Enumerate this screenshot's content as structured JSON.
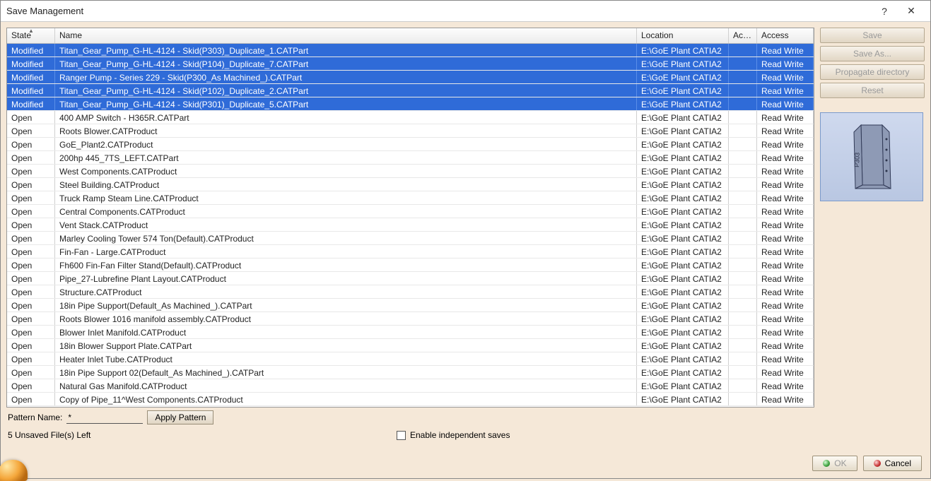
{
  "window": {
    "title": "Save Management",
    "help_tip": "?",
    "close_tip": "✕"
  },
  "columns": {
    "state": "State",
    "name": "Name",
    "location": "Location",
    "action": "Acti...",
    "access": "Access"
  },
  "rows": [
    {
      "state": "Modified",
      "name": "Titan_Gear_Pump_G-HL-4124 - Skid(P303)_Duplicate_1.CATPart",
      "location": "E:\\GoE Plant CATIA2",
      "access": "Read Write",
      "selected": true
    },
    {
      "state": "Modified",
      "name": "Titan_Gear_Pump_G-HL-4124 - Skid(P104)_Duplicate_7.CATPart",
      "location": "E:\\GoE Plant CATIA2",
      "access": "Read Write",
      "selected": true
    },
    {
      "state": "Modified",
      "name": "Ranger Pump - Series 229 - Skid(P300_As Machined_).CATPart",
      "location": "E:\\GoE Plant CATIA2",
      "access": "Read Write",
      "selected": true
    },
    {
      "state": "Modified",
      "name": "Titan_Gear_Pump_G-HL-4124 - Skid(P102)_Duplicate_2.CATPart",
      "location": "E:\\GoE Plant CATIA2",
      "access": "Read Write",
      "selected": true
    },
    {
      "state": "Modified",
      "name": "Titan_Gear_Pump_G-HL-4124 - Skid(P301)_Duplicate_5.CATPart",
      "location": "E:\\GoE Plant CATIA2",
      "access": "Read Write",
      "selected": true
    },
    {
      "state": "Open",
      "name": "400 AMP Switch - H365R.CATPart",
      "location": "E:\\GoE Plant CATIA2",
      "access": "Read Write",
      "selected": false
    },
    {
      "state": "Open",
      "name": "Roots Blower.CATProduct",
      "location": "E:\\GoE Plant CATIA2",
      "access": "Read Write",
      "selected": false
    },
    {
      "state": "Open",
      "name": "GoE_Plant2.CATProduct",
      "location": "E:\\GoE Plant CATIA2",
      "access": "Read Write",
      "selected": false
    },
    {
      "state": "Open",
      "name": "200hp 445_7TS_LEFT.CATPart",
      "location": "E:\\GoE Plant CATIA2",
      "access": "Read Write",
      "selected": false
    },
    {
      "state": "Open",
      "name": "West Components.CATProduct",
      "location": "E:\\GoE Plant CATIA2",
      "access": "Read Write",
      "selected": false
    },
    {
      "state": "Open",
      "name": "Steel Building.CATProduct",
      "location": "E:\\GoE Plant CATIA2",
      "access": "Read Write",
      "selected": false
    },
    {
      "state": "Open",
      "name": "Truck Ramp Steam Line.CATProduct",
      "location": "E:\\GoE Plant CATIA2",
      "access": "Read Write",
      "selected": false
    },
    {
      "state": "Open",
      "name": "Central Components.CATProduct",
      "location": "E:\\GoE Plant CATIA2",
      "access": "Read Write",
      "selected": false
    },
    {
      "state": "Open",
      "name": "Vent Stack.CATProduct",
      "location": "E:\\GoE Plant CATIA2",
      "access": "Read Write",
      "selected": false
    },
    {
      "state": "Open",
      "name": "Marley Cooling Tower 574 Ton(Default).CATProduct",
      "location": "E:\\GoE Plant CATIA2",
      "access": "Read Write",
      "selected": false
    },
    {
      "state": "Open",
      "name": "Fin-Fan - Large.CATProduct",
      "location": "E:\\GoE Plant CATIA2",
      "access": "Read Write",
      "selected": false
    },
    {
      "state": "Open",
      "name": "Fh600 Fin-Fan Filter Stand(Default).CATProduct",
      "location": "E:\\GoE Plant CATIA2",
      "access": "Read Write",
      "selected": false
    },
    {
      "state": "Open",
      "name": "Pipe_27-Lubrefine Plant Layout.CATProduct",
      "location": "E:\\GoE Plant CATIA2",
      "access": "Read Write",
      "selected": false
    },
    {
      "state": "Open",
      "name": "Structure.CATProduct",
      "location": "E:\\GoE Plant CATIA2",
      "access": "Read Write",
      "selected": false
    },
    {
      "state": "Open",
      "name": "18in Pipe Support(Default_As Machined_).CATPart",
      "location": "E:\\GoE Plant CATIA2",
      "access": "Read Write",
      "selected": false
    },
    {
      "state": "Open",
      "name": "Roots Blower 1016 manifold assembly.CATProduct",
      "location": "E:\\GoE Plant CATIA2",
      "access": "Read Write",
      "selected": false
    },
    {
      "state": "Open",
      "name": "Blower Inlet Manifold.CATProduct",
      "location": "E:\\GoE Plant CATIA2",
      "access": "Read Write",
      "selected": false
    },
    {
      "state": "Open",
      "name": "18in Blower Support Plate.CATPart",
      "location": "E:\\GoE Plant CATIA2",
      "access": "Read Write",
      "selected": false
    },
    {
      "state": "Open",
      "name": "Heater Inlet Tube.CATProduct",
      "location": "E:\\GoE Plant CATIA2",
      "access": "Read Write",
      "selected": false
    },
    {
      "state": "Open",
      "name": "18in Pipe Support 02(Default_As Machined_).CATPart",
      "location": "E:\\GoE Plant CATIA2",
      "access": "Read Write",
      "selected": false
    },
    {
      "state": "Open",
      "name": "Natural Gas Manifold.CATProduct",
      "location": "E:\\GoE Plant CATIA2",
      "access": "Read Write",
      "selected": false
    },
    {
      "state": "Open",
      "name": "Copy of Pipe_11^West Components.CATProduct",
      "location": "E:\\GoE Plant CATIA2",
      "access": "Read Write",
      "selected": false
    }
  ],
  "sidebar": {
    "save": "Save",
    "save_as": "Save As...",
    "propagate": "Propagate directory",
    "reset": "Reset"
  },
  "pattern": {
    "label": "Pattern Name:",
    "value": "*",
    "apply": "Apply Pattern"
  },
  "status": {
    "unsaved": "5 Unsaved File(s) Left",
    "enable_independent": "Enable independent saves"
  },
  "footer": {
    "ok": "OK",
    "cancel": "Cancel"
  }
}
